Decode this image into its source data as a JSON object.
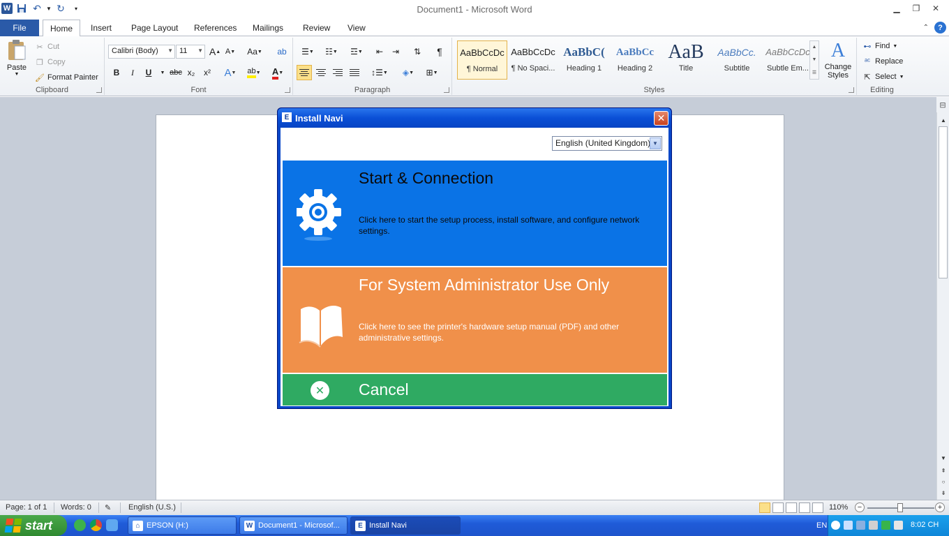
{
  "window": {
    "title": "Document1  -  Microsoft Word"
  },
  "ribbon_tabs": [
    "File",
    "Home",
    "Insert",
    "Page Layout",
    "References",
    "Mailings",
    "Review",
    "View"
  ],
  "clipboard": {
    "paste": "Paste",
    "cut": "Cut",
    "copy": "Copy",
    "format_painter": "Format Painter",
    "label": "Clipboard"
  },
  "font": {
    "name": "Calibri (Body)",
    "size": "11",
    "label": "Font",
    "bold": "B",
    "italic": "I",
    "underline": "U",
    "strike": "abc",
    "subscript": "x₂",
    "superscript": "x²",
    "grow": "A",
    "shrink": "A",
    "case": "Aa"
  },
  "paragraph": {
    "label": "Paragraph",
    "pilcrow": "¶"
  },
  "styles": {
    "label": "Styles",
    "items": [
      {
        "sample": "AaBbCcDc",
        "name": "¶ Normal"
      },
      {
        "sample": "AaBbCcDc",
        "name": "¶ No Spaci..."
      },
      {
        "sample": "AaBbC(",
        "name": "Heading 1"
      },
      {
        "sample": "AaBbCc",
        "name": "Heading 2"
      },
      {
        "sample": "AaB",
        "name": "Title"
      },
      {
        "sample": "AaBbCc.",
        "name": "Subtitle"
      },
      {
        "sample": "AaBbCcDc",
        "name": "Subtle Em..."
      }
    ],
    "change_styles": "Change Styles"
  },
  "editing": {
    "label": "Editing",
    "find": "Find",
    "replace": "Replace",
    "select": "Select"
  },
  "statusbar": {
    "page": "Page: 1 of 1",
    "words": "Words: 0",
    "language": "English (U.S.)",
    "zoom": "110%"
  },
  "taskbar": {
    "start": "start",
    "tasks": [
      "EPSON (H:)",
      "Document1 - Microsof...",
      "Install Navi"
    ],
    "input_lang": "EN",
    "clock": "8:02 CH"
  },
  "dialog": {
    "title": "Install Navi",
    "language_select": "English (United Kingdom)",
    "options": [
      {
        "title": "Start & Connection",
        "description": "Click here to start the setup process, install software, and configure network settings.",
        "color": "#0a73e6",
        "icon": "gear-icon"
      },
      {
        "title": "For System Administrator Use Only",
        "description": "Click here to see the printer's hardware setup manual (PDF) and other administrative settings.",
        "color": "#f0904a",
        "icon": "book-icon"
      }
    ],
    "cancel": "Cancel",
    "cancel_color": "#2faa62"
  }
}
